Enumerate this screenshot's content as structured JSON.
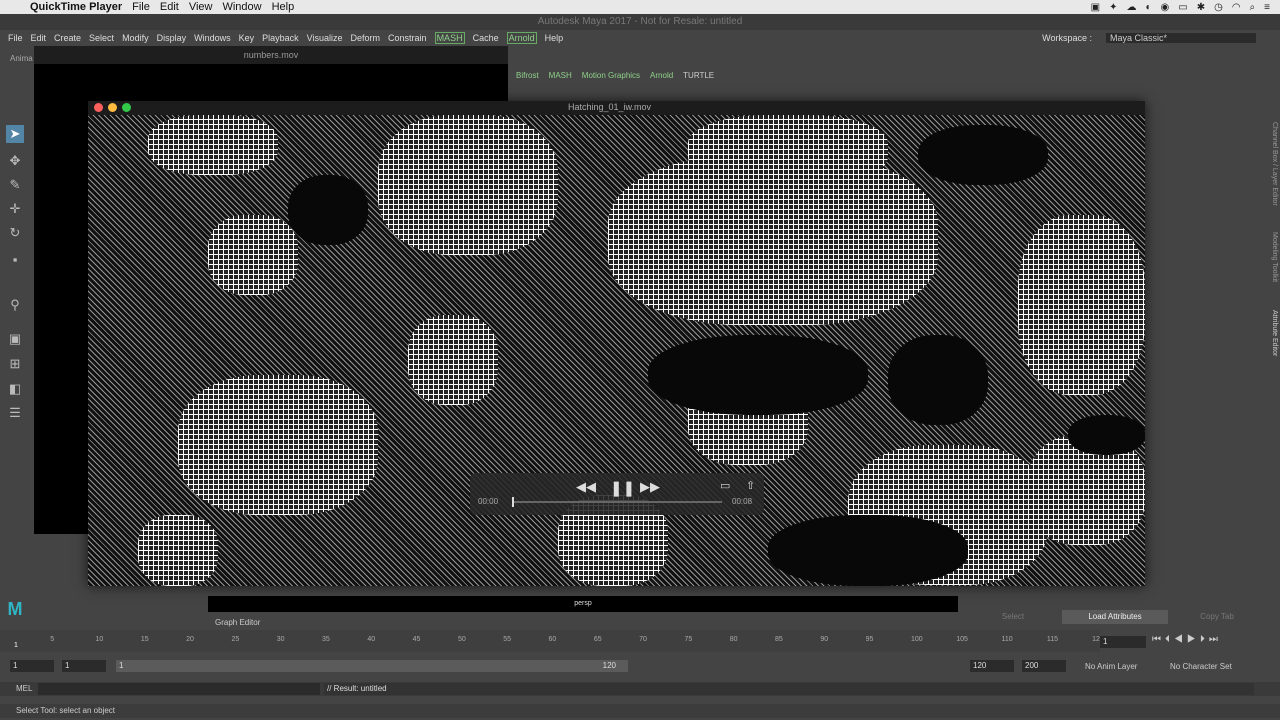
{
  "mac_menubar": {
    "app_name": "QuickTime Player",
    "items": [
      "File",
      "Edit",
      "View",
      "Window",
      "Help"
    ]
  },
  "maya": {
    "window_title": "Autodesk Maya 2017 - Not for Resale: untitled",
    "menu": [
      "File",
      "Edit",
      "Create",
      "Select",
      "Modify",
      "Display",
      "Windows",
      "Key",
      "Playback",
      "Visualize",
      "Deform",
      "Constrain",
      "MASH",
      "Cache",
      "Arnold",
      "Help"
    ],
    "workspace_label": "Workspace :",
    "workspace_value": "Maya Classic*",
    "shelf_tabs": [
      "Bifrost",
      "MASH",
      "Motion Graphics",
      "Arnold",
      "TURTLE"
    ],
    "side_tabs": [
      "Channel Box / Layer Editor",
      "Modeling Toolkit",
      "Attribute Editor"
    ],
    "left_label": "Anima",
    "viewport_label": "persp",
    "graph_editor": "Graph Editor",
    "ae_buttons": [
      "Select",
      "Load Attributes",
      "Copy Tab"
    ],
    "timeline_ticks": [
      "1",
      "5",
      "10",
      "15",
      "20",
      "25",
      "30",
      "35",
      "40",
      "45",
      "50",
      "55",
      "60",
      "65",
      "70",
      "75",
      "80",
      "85",
      "90",
      "95",
      "100",
      "105",
      "110",
      "115",
      "120"
    ],
    "current_frame": "1",
    "range": {
      "start_field": "1",
      "start_field_2": "1",
      "slider_start": "1",
      "slider_end": "120",
      "end_field": "120",
      "end_field_2": "200",
      "anim_layer": "No Anim Layer",
      "char_set": "No Character Set"
    },
    "mel_label": "MEL",
    "result": "// Result: untitled",
    "help_line": "Select Tool: select an object"
  },
  "background_video": {
    "title": "numbers.mov"
  },
  "hatching_video": {
    "title": "Hatching_01_iw.mov",
    "time_elapsed": "00:00",
    "time_remaining": "00:08",
    "progress": 0.0
  }
}
